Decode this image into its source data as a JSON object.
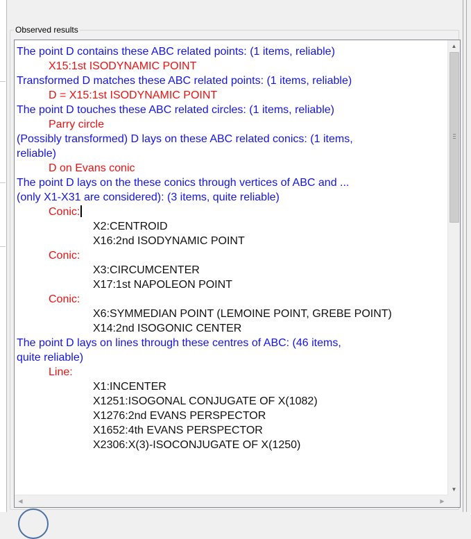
{
  "group": {
    "legend": "Observed results"
  },
  "results": {
    "lines": [
      {
        "text": "The point D contains these ABC related points: (1 items, reliable)",
        "color": "blue",
        "indent": 0
      },
      {
        "text": "X15:1st ISODYNAMIC POINT",
        "color": "red",
        "indent": 1
      },
      {
        "text": "Transformed D matches these ABC related points: (1 items, reliable)",
        "color": "blue",
        "indent": 0
      },
      {
        "text": "D = X15:1st ISODYNAMIC POINT",
        "color": "red",
        "indent": 1
      },
      {
        "text": "The point D touches these ABC related circles: (1 items, reliable)",
        "color": "blue",
        "indent": 0
      },
      {
        "text": "Parry circle",
        "color": "red",
        "indent": 1
      },
      {
        "text": "(Possibly transformed) D lays on these ABC related conics: (1 items,",
        "color": "blue",
        "indent": 0
      },
      {
        "text": "reliable)",
        "color": "blue",
        "indent": 0
      },
      {
        "text": "D on Evans conic",
        "color": "red",
        "indent": 1
      },
      {
        "text": "The point D lays on the these conics through vertices of ABC and ...",
        "color": "blue",
        "indent": 0
      },
      {
        "text": "(only X1-X31 are considered): (3 items, quite reliable)",
        "color": "blue",
        "indent": 0
      },
      {
        "text": "Conic:",
        "color": "red",
        "indent": 1,
        "caret": true
      },
      {
        "text": "X2:CENTROID",
        "color": "black",
        "indent": 2
      },
      {
        "text": "X16:2nd ISODYNAMIC POINT",
        "color": "black",
        "indent": 2
      },
      {
        "text": "Conic:",
        "color": "red",
        "indent": 1
      },
      {
        "text": "X3:CIRCUMCENTER",
        "color": "black",
        "indent": 2
      },
      {
        "text": "X17:1st NAPOLEON POINT",
        "color": "black",
        "indent": 2
      },
      {
        "text": "Conic:",
        "color": "red",
        "indent": 1
      },
      {
        "text": "X6:SYMMEDIAN POINT (LEMOINE POINT, GREBE POINT)",
        "color": "black",
        "indent": 2
      },
      {
        "text": "X14:2nd ISOGONIC CENTER",
        "color": "black",
        "indent": 2
      },
      {
        "text": "The point D lays on lines through these centres of ABC: (46 items,",
        "color": "blue",
        "indent": 0
      },
      {
        "text": "quite reliable)",
        "color": "blue",
        "indent": 0
      },
      {
        "text": "Line:",
        "color": "red",
        "indent": 1
      },
      {
        "text": "X1:INCENTER",
        "color": "black",
        "indent": 2
      },
      {
        "text": "X1251:ISOGONAL CONJUGATE OF X(1082)",
        "color": "black",
        "indent": 2
      },
      {
        "text": "X1276:2nd EVANS PERSPECTOR",
        "color": "black",
        "indent": 2
      },
      {
        "text": "X1652:4th EVANS PERSPECTOR",
        "color": "black",
        "indent": 2
      },
      {
        "text": "X2306:X(3)-ISOCONJUGATE OF X(1250)",
        "color": "black",
        "indent": 2
      }
    ]
  },
  "scrollbars": {
    "vertical": {
      "up_icon": "triangle-up-icon",
      "down_icon": "triangle-down-icon",
      "position": 0.0
    },
    "horizontal": {
      "left_icon": "triangle-left-icon",
      "right_icon": "triangle-right-icon"
    }
  }
}
